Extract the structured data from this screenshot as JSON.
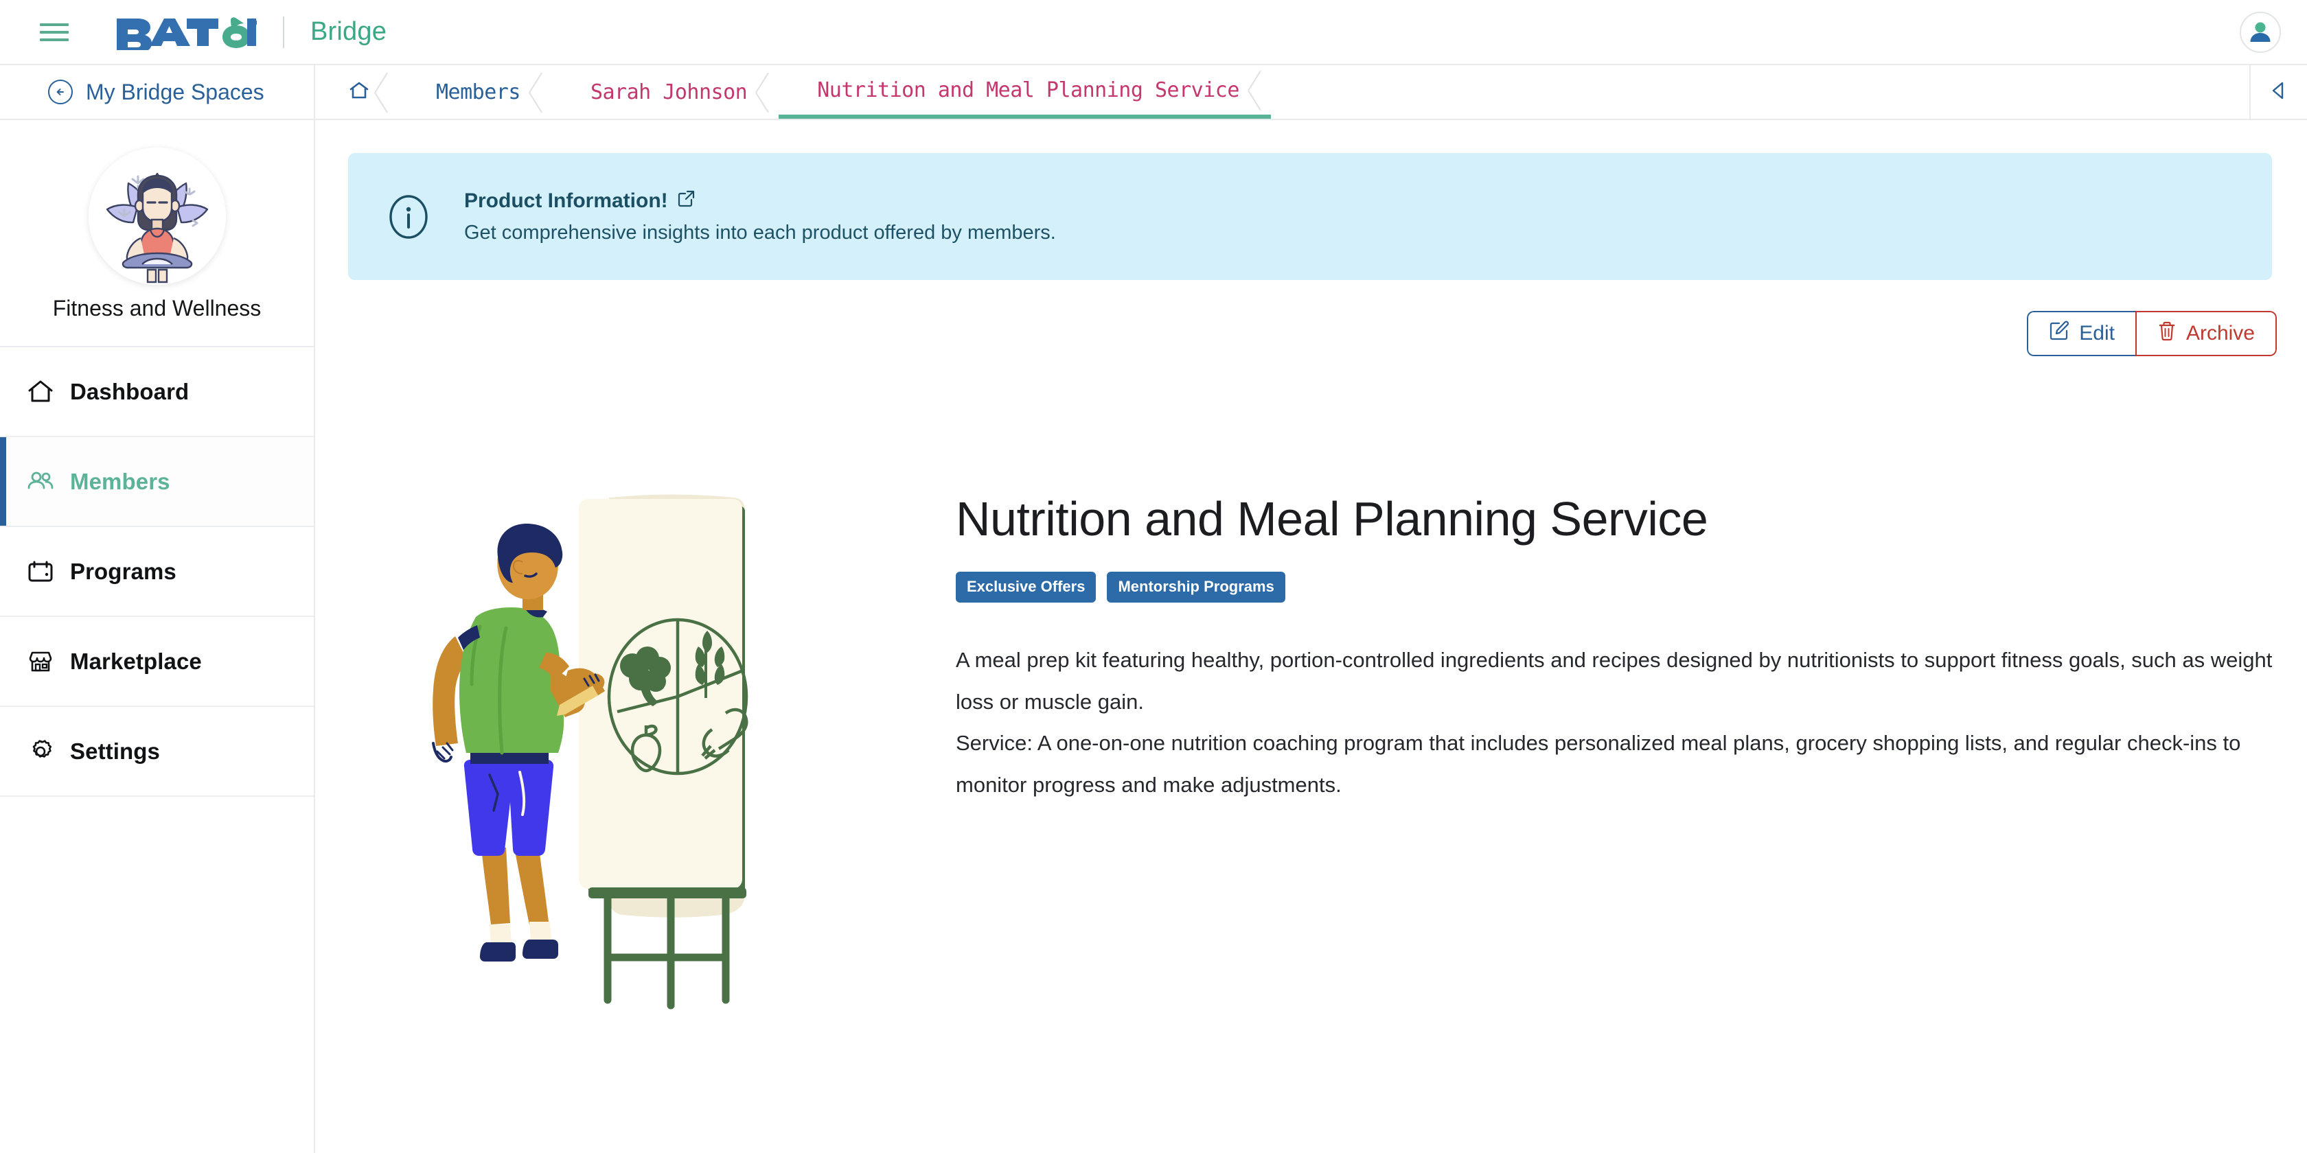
{
  "header": {
    "menu_icon": "hamburger-icon",
    "logo_text": "BATOI",
    "logo_registered": "®",
    "product_name": "Bridge",
    "avatar_icon": "user-avatar-icon"
  },
  "sidebar": {
    "back_label": "My Bridge Spaces",
    "back_icon": "arrow-left-circle-icon",
    "space_name": "Fitness and Wellness",
    "space_avatar_icon": "yoga-lotus-avatar-icon",
    "items": [
      {
        "label": "Dashboard",
        "icon": "home-icon",
        "active": false
      },
      {
        "label": "Members",
        "icon": "users-icon",
        "active": true
      },
      {
        "label": "Programs",
        "icon": "calendar-icon",
        "active": false
      },
      {
        "label": "Marketplace",
        "icon": "storefront-icon",
        "active": false
      },
      {
        "label": "Settings",
        "icon": "gear-icon",
        "active": false
      }
    ]
  },
  "breadcrumb": {
    "home_icon": "home-icon",
    "items": [
      {
        "label": "Members",
        "current": false
      },
      {
        "label": "Sarah Johnson",
        "current": false
      },
      {
        "label": "Nutrition and Meal Planning Service",
        "current": true
      }
    ],
    "collapse_icon": "chevron-left-icon"
  },
  "banner": {
    "icon": "info-circle-icon",
    "title": "Product Information!",
    "external_link_icon": "external-link-icon",
    "subtitle": "Get comprehensive insights into each product offered by members."
  },
  "actions": {
    "edit_label": "Edit",
    "edit_icon": "pencil-square-icon",
    "archive_label": "Archive",
    "archive_icon": "trash-icon"
  },
  "product": {
    "illustration_icon": "person-drawing-nutrition-plate-illustration",
    "title": "Nutrition and Meal Planning Service",
    "tags": [
      "Exclusive Offers",
      "Mentorship Programs"
    ],
    "description_paragraphs": [
      "A meal prep kit featuring healthy, portion-controlled ingredients and recipes designed by nutritionists to support fitness goals, such as weight loss or muscle gain.",
      "Service: A one-on-one nutrition coaching program that includes personalized meal plans, grocery shopping lists, and regular check-ins to monitor progress and make adjustments."
    ]
  },
  "colors": {
    "brand_blue": "#2a6099",
    "brand_green": "#3aa884",
    "accent_pink": "#c4376f",
    "badge_blue": "#2c6aa8",
    "banner_bg": "#d4f0fa",
    "danger_red": "#c0392f"
  }
}
